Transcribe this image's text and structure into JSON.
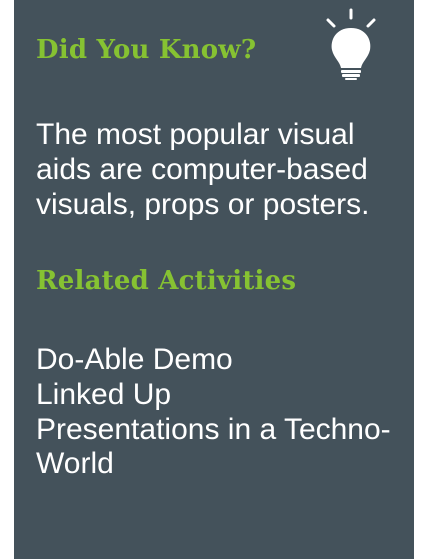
{
  "did_you_know": {
    "heading": "Did You Know?",
    "icon": "lightbulb-icon",
    "fact": "The most popular visual aids are computer-based visuals, props or posters."
  },
  "related": {
    "heading": "Related Activities",
    "items": [
      {
        "label": "Do-Able Demo"
      },
      {
        "label": "Linked Up"
      },
      {
        "label": "Presentations in a Techno-World"
      }
    ]
  },
  "colors": {
    "card_background": "#44525b",
    "heading": "#86c232",
    "text": "#ffffff"
  }
}
